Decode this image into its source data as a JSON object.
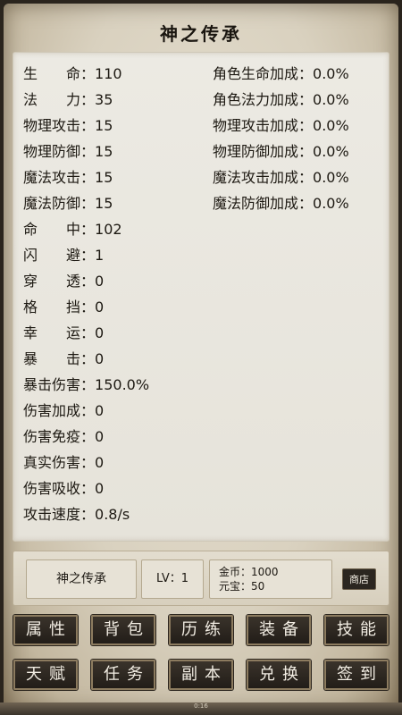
{
  "title": "神之传承",
  "left_stats": [
    {
      "label": "生命",
      "value": "110",
      "spaced": true
    },
    {
      "label": "法力",
      "value": "35",
      "spaced": true
    },
    {
      "label": "物理攻击",
      "value": "15",
      "spaced": false
    },
    {
      "label": "物理防御",
      "value": "15",
      "spaced": false
    },
    {
      "label": "魔法攻击",
      "value": "15",
      "spaced": false
    },
    {
      "label": "魔法防御",
      "value": "15",
      "spaced": false
    },
    {
      "label": "命中",
      "value": "102",
      "spaced": true
    },
    {
      "label": "闪避",
      "value": "1",
      "spaced": true
    },
    {
      "label": "穿透",
      "value": "0",
      "spaced": true
    },
    {
      "label": "格挡",
      "value": "0",
      "spaced": true
    },
    {
      "label": "幸运",
      "value": "0",
      "spaced": true
    },
    {
      "label": "暴击",
      "value": "0",
      "spaced": true
    },
    {
      "label": "暴击伤害",
      "value": "150.0%",
      "spaced": false
    },
    {
      "label": "伤害加成",
      "value": "0",
      "spaced": false
    },
    {
      "label": "伤害免疫",
      "value": "0",
      "spaced": false
    },
    {
      "label": "真实伤害",
      "value": "0",
      "spaced": false
    },
    {
      "label": "伤害吸收",
      "value": "0",
      "spaced": false
    },
    {
      "label": "攻击速度",
      "value": "0.8/s",
      "spaced": false
    }
  ],
  "right_stats": [
    {
      "label": "角色生命加成",
      "value": "0.0%"
    },
    {
      "label": "角色法力加成",
      "value": "0.0%"
    },
    {
      "label": "物理攻击加成",
      "value": "0.0%"
    },
    {
      "label": "物理防御加成",
      "value": "0.0%"
    },
    {
      "label": "魔法攻击加成",
      "value": "0.0%"
    },
    {
      "label": "魔法防御加成",
      "value": "0.0%"
    }
  ],
  "separator": "：",
  "info": {
    "player_name": "神之传承",
    "level": "LV：1",
    "gold": "金币：1000",
    "yuanbao": "元宝：50",
    "shop_label": "商店"
  },
  "nav_row1": [
    "属性",
    "背包",
    "历练",
    "装备",
    "技能"
  ],
  "nav_row2": [
    "天赋",
    "任务",
    "副本",
    "兑换",
    "签到"
  ],
  "footer_text": "0:16"
}
